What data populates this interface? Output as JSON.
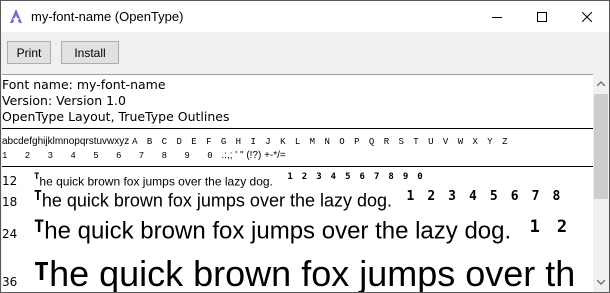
{
  "window": {
    "title": "my-font-name (OpenType)"
  },
  "toolbar": {
    "print_label": "Print",
    "install_label": "Install"
  },
  "font_info": {
    "name_line": "Font name: my-font-name",
    "version_line": "Version: Version 1.0",
    "type_line": "OpenType Layout, TrueType Outlines"
  },
  "charset": {
    "lowercase": "abcdefghijklmnopqrstuvwxyz",
    "uppercase": "A B C D E F G H I J K L M N O P Q R S T U V W X Y Z",
    "digits": "1 2 3 4 5 6 7 8 9 0",
    "punctuation": ".:,; ' \" (!?) +-*/="
  },
  "samples": [
    {
      "size": "12",
      "cap": "T",
      "text": "he quick brown fox jumps over the lazy dog.",
      "digits": "1 2 3 4 5 6 7 8 9 0"
    },
    {
      "size": "18",
      "cap": "T",
      "text": "he quick brown fox jumps over the lazy dog.",
      "digits": "1 2 3 4 5 6 7 8"
    },
    {
      "size": "24",
      "cap": "T",
      "text": "he quick brown fox jumps over the lazy dog.",
      "digits": "1 2"
    },
    {
      "size": "36",
      "cap": "T",
      "text": "he quick brown fox jumps over th",
      "digits": ""
    }
  ]
}
